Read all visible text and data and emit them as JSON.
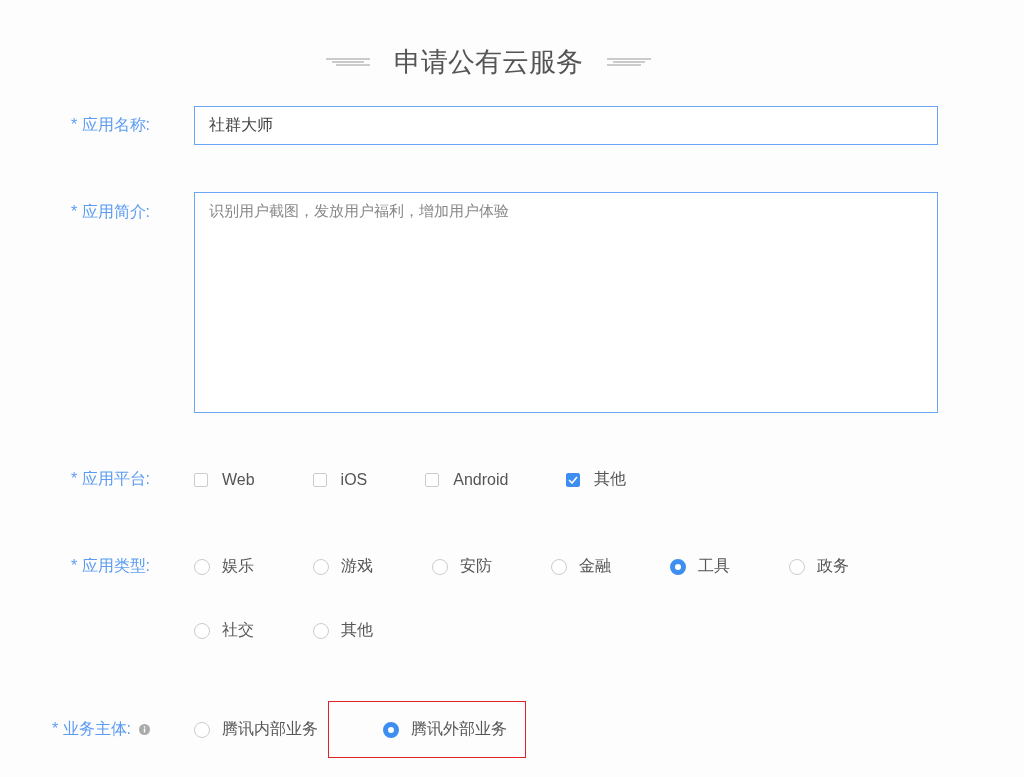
{
  "title": "申请公有云服务",
  "name_field": {
    "label": "* 应用名称:",
    "value": "社群大师"
  },
  "intro_field": {
    "label": "* 应用简介:",
    "placeholder": "识别用户截图，发放用户福利，增加用户体验"
  },
  "platform": {
    "label": "* 应用平台:",
    "options": [
      {
        "label": "Web",
        "checked": false
      },
      {
        "label": "iOS",
        "checked": false
      },
      {
        "label": "Android",
        "checked": false
      },
      {
        "label": "其他",
        "checked": true
      }
    ]
  },
  "app_type": {
    "label": "* 应用类型:",
    "options": [
      {
        "label": "娱乐",
        "selected": false
      },
      {
        "label": "游戏",
        "selected": false
      },
      {
        "label": "安防",
        "selected": false
      },
      {
        "label": "金融",
        "selected": false
      },
      {
        "label": "工具",
        "selected": true
      },
      {
        "label": "政务",
        "selected": false
      },
      {
        "label": "社交",
        "selected": false
      },
      {
        "label": "其他",
        "selected": false
      }
    ]
  },
  "business": {
    "label": "*  业务主体:",
    "options": [
      {
        "label": "腾讯内部业务",
        "selected": false,
        "highlighted": false
      },
      {
        "label": "腾讯外部业务",
        "selected": true,
        "highlighted": true
      }
    ]
  }
}
